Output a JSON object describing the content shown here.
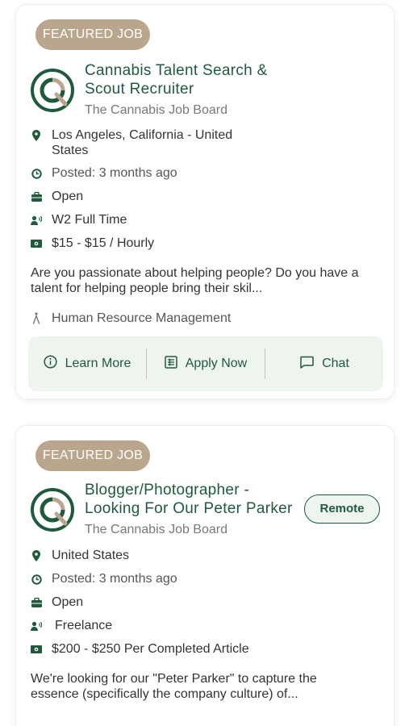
{
  "jobs": [
    {
      "badge": "FEATURED JOB",
      "title_line1": "Cannabis Talent Search &",
      "title_line2": "Scout Recruiter",
      "company": "The Cannabis Job Board",
      "location_line1": "Los Angeles, California - United",
      "location_line2": "States",
      "posted": "Posted: 3 months ago",
      "status": "Open",
      "job_type": "W2 Full Time",
      "pay": "$15 - $15 / Hourly",
      "description_line1": "Are you passionate about helping people? Do you have a",
      "description_line2": "talent for helping people bring their skil...",
      "category": "Human Resource Management",
      "actions": {
        "learn_more": "Learn More",
        "apply_now": "Apply Now",
        "chat": "Chat"
      }
    },
    {
      "badge": "FEATURED JOB",
      "title_line1": "Blogger/Photographer -",
      "title_line2": "Looking For Our Peter Parker",
      "remote_badge": "Remote",
      "company": "The Cannabis Job Board",
      "location_line1": "United States",
      "posted": "Posted: 3 months ago",
      "status": "Open",
      "job_type": "Freelance",
      "pay": "$200 - $250 Per Completed Article",
      "description_line1": "We're looking for our \"Peter Parker\" to capture the",
      "description_line2": "essence (specifically the company culture) of..."
    }
  ],
  "icons": {
    "location": "map-pin-icon",
    "posted": "clock-icon",
    "status": "briefcase-icon",
    "job_type": "person-icon",
    "pay": "money-icon",
    "category": "person-walking-icon",
    "learn_more": "info-icon",
    "apply_now": "list-icon",
    "chat": "chat-icon"
  },
  "colors": {
    "brand_green": "#1f5a3c",
    "badge_tan": "#b9a68c",
    "action_bg": "#eef5ee"
  }
}
